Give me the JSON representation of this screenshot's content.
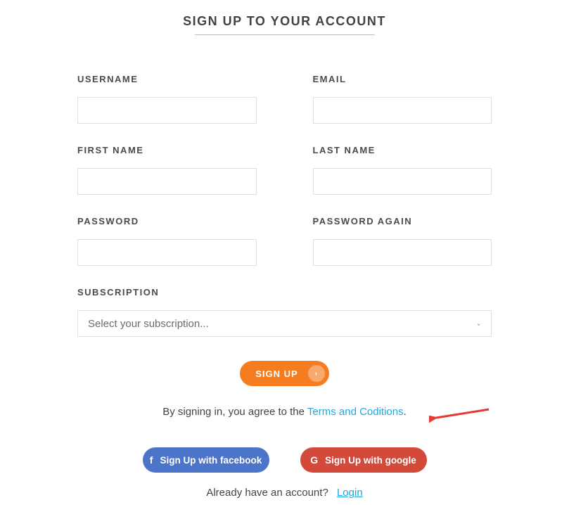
{
  "title": "SIGN UP TO YOUR ACCOUNT",
  "fields": {
    "username": {
      "label": "USERNAME",
      "value": ""
    },
    "email": {
      "label": "EMAIL",
      "value": ""
    },
    "first_name": {
      "label": "FIRST NAME",
      "value": ""
    },
    "last_name": {
      "label": "LAST NAME",
      "value": ""
    },
    "password": {
      "label": "PASSWORD",
      "value": ""
    },
    "password_again": {
      "label": "PASSWORD AGAIN",
      "value": ""
    },
    "subscription": {
      "label": "SUBSCRIPTION",
      "placeholder": "Select your subscription..."
    }
  },
  "signup_button": "SIGN UP",
  "agree_prefix": "By signing in, you agree to the ",
  "agree_link": "Terms and Coditions",
  "agree_suffix": ".",
  "social": {
    "facebook": "Sign Up with facebook",
    "google": "Sign Up with google"
  },
  "footer_text": "Already have an account?",
  "footer_link": "Login",
  "colors": {
    "accent": "#f57c1f",
    "facebook": "#4c74c9",
    "google": "#d34a3a",
    "link": "#1ca9e0"
  }
}
